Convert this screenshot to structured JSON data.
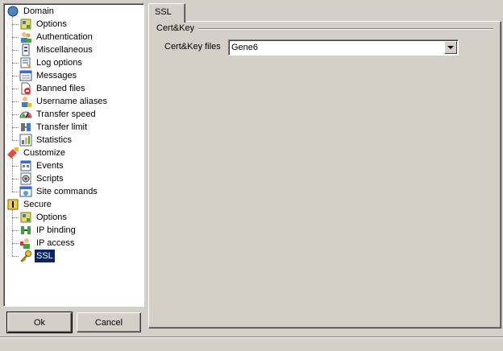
{
  "tree": {
    "items": [
      {
        "label": "Domain",
        "level": 0,
        "icon": "globe-icon"
      },
      {
        "label": "Options",
        "level": 1,
        "icon": "options-icon"
      },
      {
        "label": "Authentication",
        "level": 1,
        "icon": "users-icon"
      },
      {
        "label": "Miscellaneous",
        "level": 1,
        "icon": "misc-icon"
      },
      {
        "label": "Log options",
        "level": 1,
        "icon": "log-icon"
      },
      {
        "label": "Messages",
        "level": 1,
        "icon": "messages-icon"
      },
      {
        "label": "Banned files",
        "level": 1,
        "icon": "banned-file-icon"
      },
      {
        "label": "Username aliases",
        "level": 1,
        "icon": "user-alias-icon"
      },
      {
        "label": "Transfer speed",
        "level": 1,
        "icon": "speed-gauge-icon"
      },
      {
        "label": "Transfer limit",
        "level": 1,
        "icon": "limit-icon"
      },
      {
        "label": "Statistics",
        "level": 1,
        "icon": "statistics-icon"
      },
      {
        "label": "Customize",
        "level": 0,
        "icon": "customize-icon"
      },
      {
        "label": "Events",
        "level": 1,
        "icon": "events-icon"
      },
      {
        "label": "Scripts",
        "level": 1,
        "icon": "scripts-icon"
      },
      {
        "label": "Site commands",
        "level": 1,
        "icon": "site-commands-icon"
      },
      {
        "label": "Secure",
        "level": 0,
        "icon": "secure-icon"
      },
      {
        "label": "Options",
        "level": 1,
        "icon": "options-icon"
      },
      {
        "label": "IP binding",
        "level": 1,
        "icon": "ip-binding-icon"
      },
      {
        "label": "IP access",
        "level": 1,
        "icon": "ip-access-icon"
      },
      {
        "label": "SSL",
        "level": 1,
        "icon": "key-icon",
        "selected": true
      }
    ]
  },
  "buttons": {
    "ok_label": "Ok",
    "cancel_label": "Cancel"
  },
  "tabs": [
    {
      "label": "SSL",
      "active": true
    }
  ],
  "group": {
    "title": "Cert&Key"
  },
  "fields": {
    "cert_key_label": "Cert&Key files",
    "cert_key_value": "Gene6"
  },
  "colors": {
    "window_bg": "#d4d0c8",
    "selection_bg": "#0a246a",
    "selection_fg": "#ffffff"
  }
}
